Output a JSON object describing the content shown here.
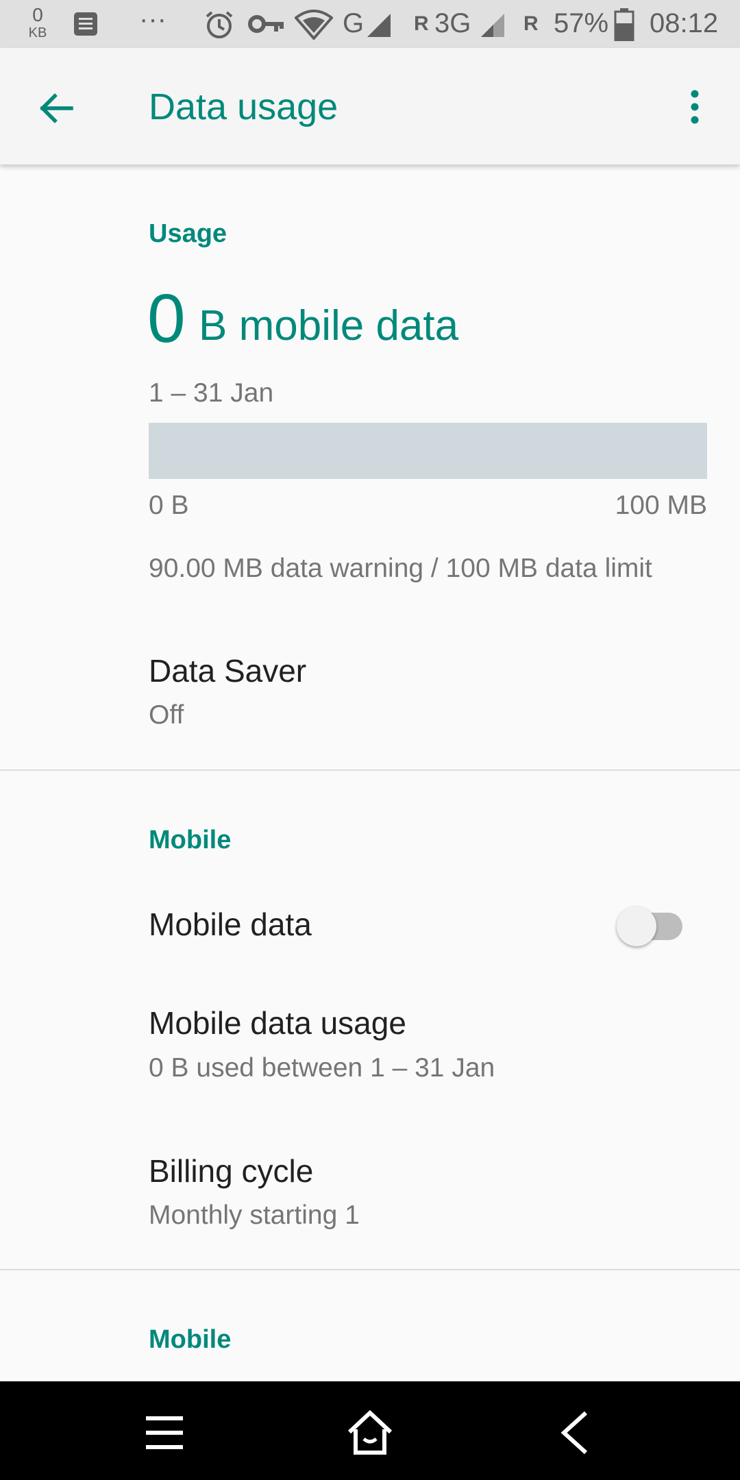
{
  "status_bar": {
    "net_speed_value": "0",
    "net_speed_unit": "KB",
    "more_notifications": "···",
    "network_g": "G",
    "roaming_1": "R",
    "network_3g": "3G",
    "roaming_2": "R",
    "battery_percent": "57%",
    "time": "08:12"
  },
  "app_bar": {
    "title": "Data usage"
  },
  "usage": {
    "section_label": "Usage",
    "amount": "0",
    "amount_unit": "B mobile data",
    "period": "1 – 31 Jan",
    "bar_min_label": "0 B",
    "bar_max_label": "100 MB",
    "bar_fill_fraction": 0,
    "warning_limit": "90.00 MB data warning / 100 MB data limit"
  },
  "data_saver": {
    "title": "Data Saver",
    "value": "Off"
  },
  "mobile_section": {
    "section_label": "Mobile",
    "mobile_data_label": "Mobile data",
    "mobile_data_enabled": false,
    "mobile_data_usage_title": "Mobile data usage",
    "mobile_data_usage_sub": "0 B used between 1 – 31 Jan",
    "billing_cycle_title": "Billing cycle",
    "billing_cycle_sub": "Monthly starting 1"
  },
  "mobile_section_2": {
    "section_label": "Mobile"
  },
  "colors": {
    "accent": "#00897b",
    "status_bar_bg": "#e0e0e0",
    "nav_bar_bg": "#000000",
    "bar_bg": "#cfd8dc"
  },
  "icons": {
    "status": [
      "notes-icon",
      "alarm-icon",
      "vpn-key-icon",
      "wifi-icon",
      "signal-icon",
      "signal-icon",
      "battery-icon"
    ],
    "nav": [
      "recents-icon",
      "home-icon",
      "back-icon"
    ]
  }
}
